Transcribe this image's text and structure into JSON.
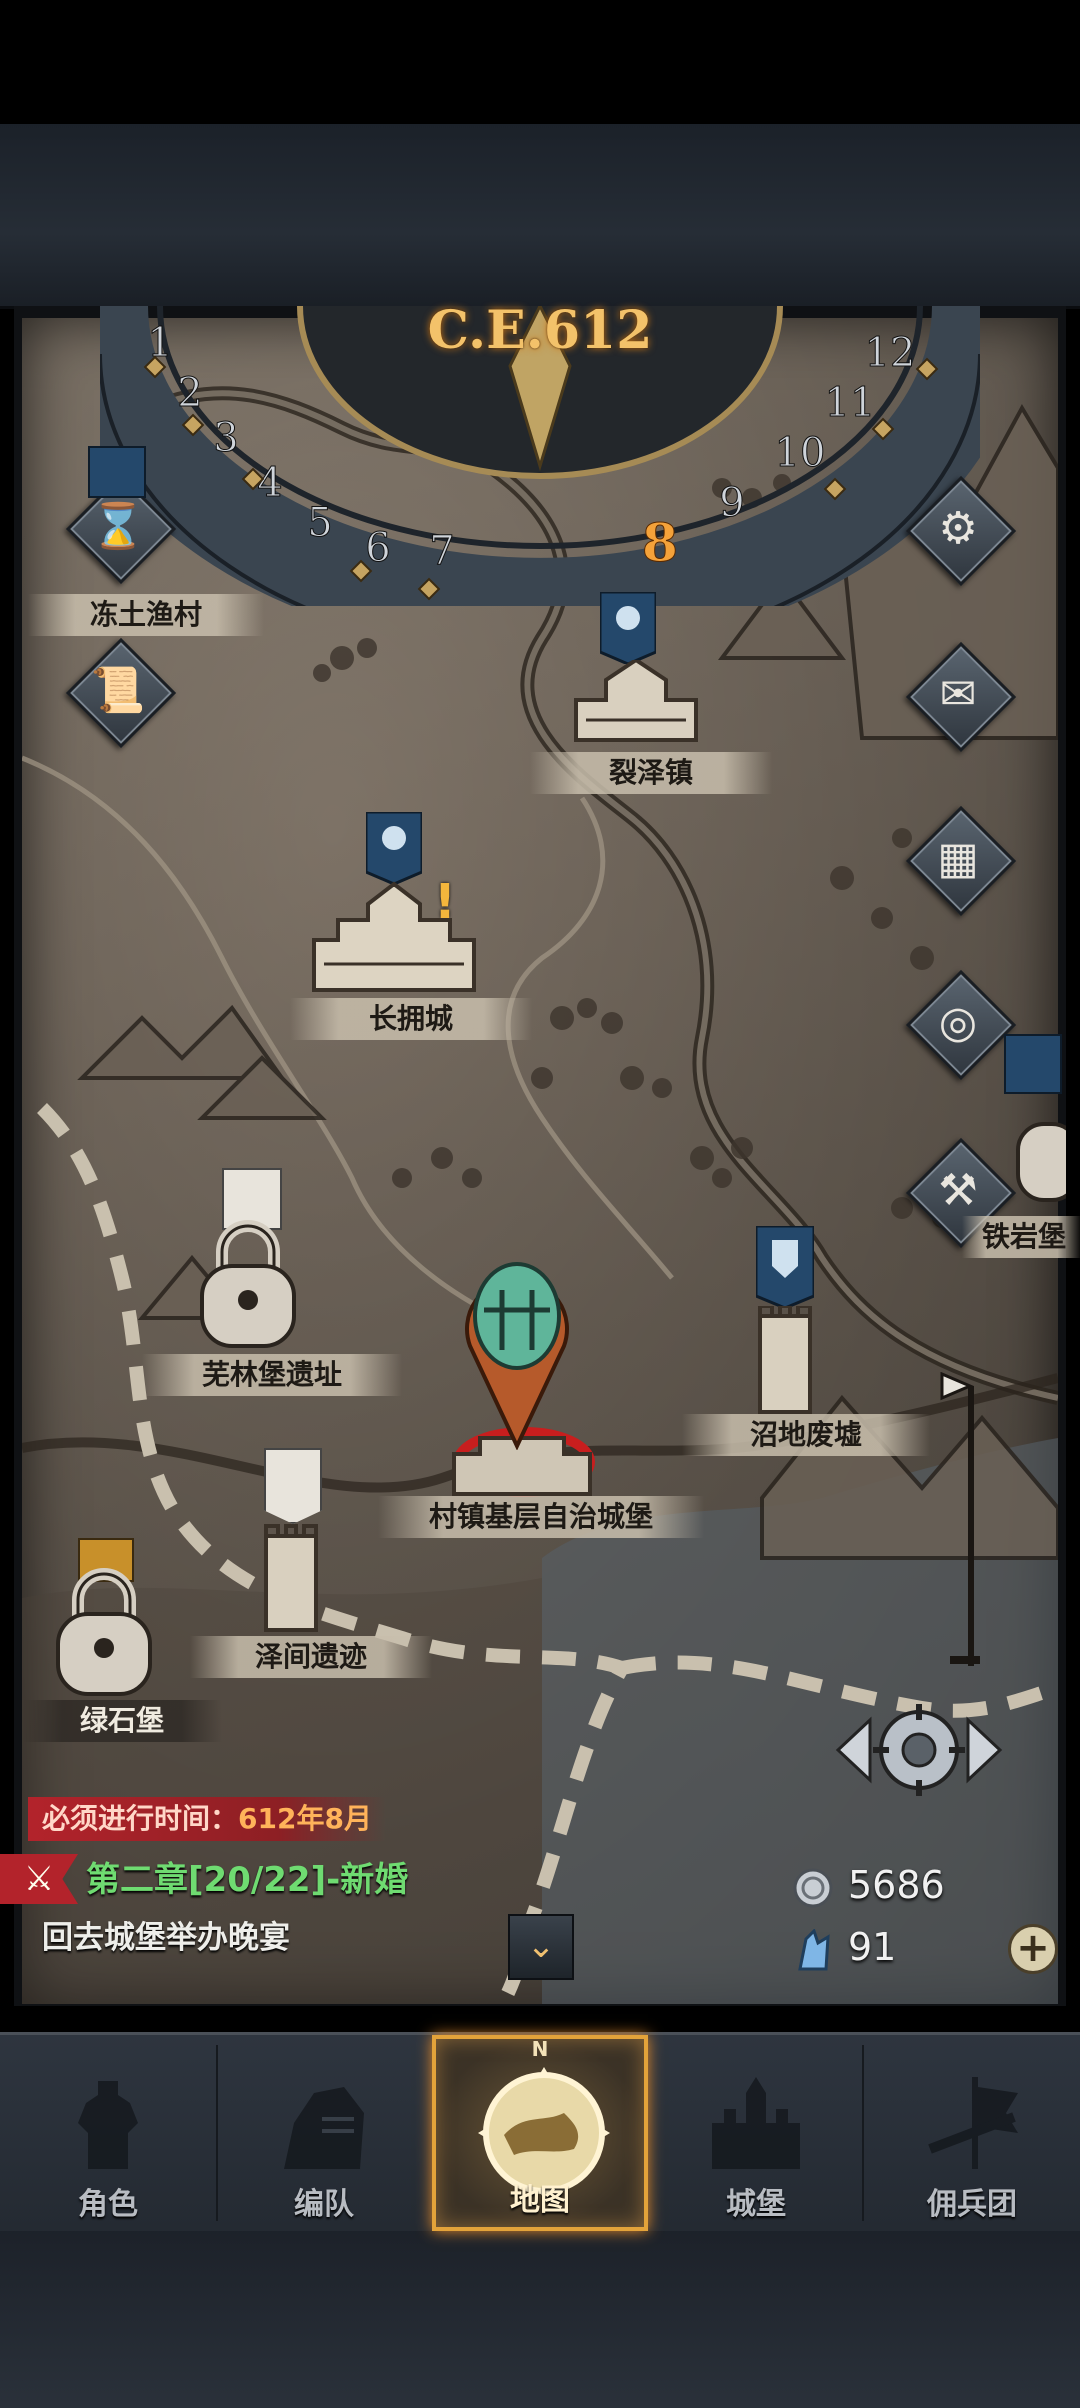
{
  "calendar": {
    "year": "C.E.612",
    "months": [
      "1",
      "2",
      "3",
      "4",
      "5",
      "6",
      "7",
      "8",
      "9",
      "10",
      "11",
      "12"
    ],
    "current_month": "8"
  },
  "locations": [
    {
      "id": "frozen-fishing-village",
      "name": "冻土渔村"
    },
    {
      "id": "rift-town",
      "name": "裂泽镇"
    },
    {
      "id": "changyong-city",
      "name": "长拥城"
    },
    {
      "id": "wufei-ruins",
      "name": "芜林堡遗址"
    },
    {
      "id": "marsh-ruins",
      "name": "沼地废墟"
    },
    {
      "id": "home-castle",
      "name": "村镇基层自治城堡"
    },
    {
      "id": "zejian-ruins",
      "name": "泽间遗迹"
    },
    {
      "id": "greenstone-fort",
      "name": "绿石堡"
    },
    {
      "id": "ironrock-fort",
      "name": "铁岩堡"
    }
  ],
  "side_buttons": [
    {
      "id": "settings",
      "icon": "gear-icon"
    },
    {
      "id": "mail",
      "icon": "envelope-icon"
    },
    {
      "id": "calendar",
      "icon": "grid-icon"
    },
    {
      "id": "coins",
      "icon": "coin-icon"
    },
    {
      "id": "trade",
      "icon": "hammer-icon"
    }
  ],
  "left_buttons": [
    {
      "id": "time",
      "icon": "hourglass-icon"
    },
    {
      "id": "scroll",
      "icon": "scroll-icon"
    }
  ],
  "quest": {
    "deadline_label": "必须进行时间：",
    "deadline_value": "612年8月",
    "chapter": "第二章[20/22]-新婚",
    "description": "回去城堡举办晚宴"
  },
  "resources": {
    "silver": "5686",
    "crystal": "91",
    "plus": "+"
  },
  "nav": [
    {
      "id": "character",
      "label": "角色"
    },
    {
      "id": "team",
      "label": "编队"
    },
    {
      "id": "map",
      "label": "地图",
      "active": true
    },
    {
      "id": "castle",
      "label": "城堡"
    },
    {
      "id": "mercenary",
      "label": "佣兵团"
    }
  ],
  "compass_n": "N",
  "alert_mark": "!"
}
